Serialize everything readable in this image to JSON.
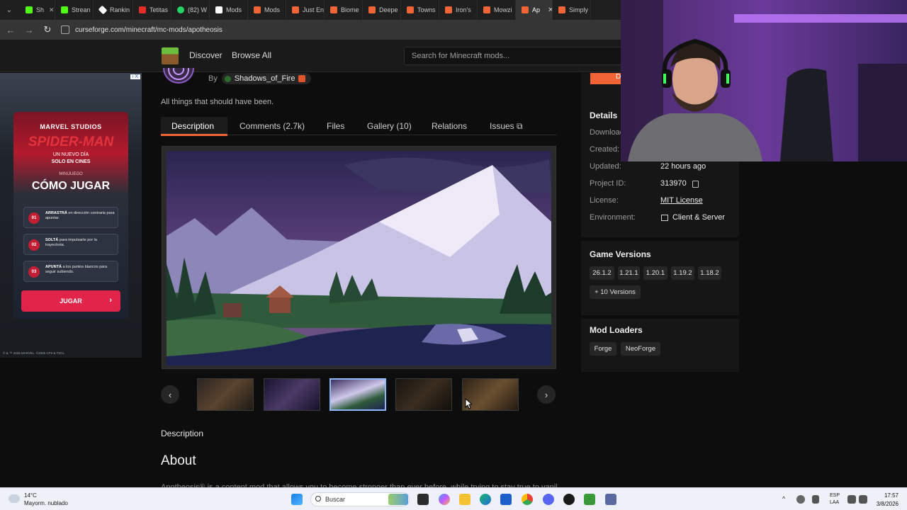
{
  "browser": {
    "tabs": [
      {
        "label": "Sh",
        "favicon": "kick-icon"
      },
      {
        "label": "Strean",
        "favicon": "kick-icon"
      },
      {
        "label": "Rankin",
        "favicon": "ranking-icon"
      },
      {
        "label": "Tetitas",
        "favicon": "red-icon"
      },
      {
        "label": "(82) W",
        "favicon": "whatsapp-icon"
      },
      {
        "label": "Mods",
        "favicon": "mods-icon"
      },
      {
        "label": "Mods",
        "favicon": "curseforge-icon"
      },
      {
        "label": "Just En",
        "favicon": "curseforge-icon"
      },
      {
        "label": "Biome",
        "favicon": "curseforge-icon"
      },
      {
        "label": "Deepe",
        "favicon": "curseforge-icon"
      },
      {
        "label": "Towns",
        "favicon": "curseforge-icon"
      },
      {
        "label": "Iron's",
        "favicon": "curseforge-icon"
      },
      {
        "label": "Mowzi",
        "favicon": "curseforge-icon"
      },
      {
        "label": "Ap",
        "favicon": "curseforge-icon",
        "active": true
      },
      {
        "label": "Simply",
        "favicon": "curseforge-icon"
      }
    ],
    "url": "curseforge.com/minecraft/mc-mods/apotheosis"
  },
  "site_header": {
    "nav": [
      "Discover",
      "Browse All"
    ],
    "search_placeholder": "Search for Minecraft mods..."
  },
  "ad": {
    "badge": "i X",
    "studio": "MARVEL STUDIOS",
    "title": "SPIDER-MAN",
    "subtitle": "UN NUEVO DÍA",
    "tagline": "SOLO EN CINES",
    "minigame": "MINIJUEGO",
    "heading": "CÓMO JUGAR",
    "steps": [
      {
        "num": "01",
        "bold": "ARRASTRÁ",
        "text": " en dirección contraria para apuntar."
      },
      {
        "num": "02",
        "bold": "SOLTÁ",
        "text": " para impulsarte por la trayectoria."
      },
      {
        "num": "03",
        "bold": "APUNTÁ",
        "text": " a los puntos blancos para seguir subiendo."
      }
    ],
    "cta": "JUGAR",
    "legal": "© & ™ 2026 MARVEL. ©2026 CPII & TSCL"
  },
  "project": {
    "by_label": "By",
    "author": "Shadows_of_Fire",
    "summary": "All things that should have been.",
    "tabs": [
      "Description",
      "Comments (2.7k)",
      "Files",
      "Gallery (10)",
      "Relations",
      "Issues"
    ],
    "selected_tab": "Description",
    "gallery": {
      "thumb_count": 5,
      "selected_thumb": 3
    },
    "description_label": "Description",
    "about_heading": "About",
    "about_text": "Apotheosis® is a content mod that allows you to become stronger than ever before, while trying to stay true to vanilla"
  },
  "sidebar": {
    "download_label": "D",
    "details_title": "Details",
    "details": [
      {
        "label": "Downloads:",
        "value": ""
      },
      {
        "label": "Created:",
        "value": ""
      },
      {
        "label": "Updated:",
        "value": "22 hours ago"
      },
      {
        "label": "Project ID:",
        "value": "313970"
      },
      {
        "label": "License:",
        "value": "MIT License"
      },
      {
        "label": "Environment:",
        "value": "Client & Server"
      }
    ],
    "versions_title": "Game Versions",
    "versions": [
      "26.1.2",
      "1.21.1",
      "1.20.1",
      "1.19.2",
      "1.18.2"
    ],
    "more_versions": "+ 10 Versions",
    "loaders_title": "Mod Loaders",
    "loaders": [
      "Forge",
      "NeoForge"
    ]
  },
  "taskbar": {
    "temp": "14°C",
    "weather": "Mayorm. nublado",
    "search_label": "Buscar",
    "lang_top": "ESP",
    "lang_bottom": "LAA",
    "time": "17:57",
    "date": "3/8/2026"
  },
  "colors": {
    "accent": "#f16436",
    "page_bg": "#0d0d0d",
    "panel_bg": "#161616"
  }
}
